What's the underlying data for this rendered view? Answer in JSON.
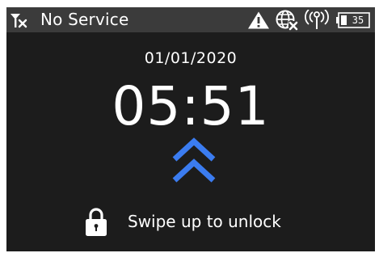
{
  "status_bar": {
    "carrier": "No Service",
    "signal_icon": "no-signal-icon",
    "icons": [
      "warning-icon",
      "globe-x-icon",
      "radio-broadcast-icon",
      "battery-icon"
    ],
    "battery_level": "35"
  },
  "lock_screen": {
    "date": "01/01/2020",
    "time": "05:51",
    "swipe_icon": "double-chevron-up-icon",
    "lock_icon": "lock-icon",
    "unlock_hint": "Swipe up to unlock"
  },
  "colors": {
    "background": "#1c1c1c",
    "status_bar": "#3b3b3b",
    "accent": "#3b7cf0",
    "text": "#ffffff"
  }
}
